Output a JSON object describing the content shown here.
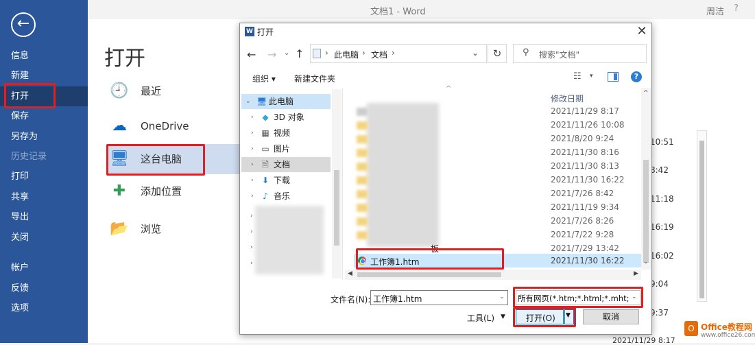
{
  "word": {
    "title": "文档1  -  Word",
    "user": "周洁",
    "help": "?"
  },
  "sidebar": {
    "items": [
      {
        "label": "信息"
      },
      {
        "label": "新建"
      },
      {
        "label": "打开"
      },
      {
        "label": "保存"
      },
      {
        "label": "另存为"
      },
      {
        "label": "历史记录"
      },
      {
        "label": "打印"
      },
      {
        "label": "共享"
      },
      {
        "label": "导出"
      },
      {
        "label": "关闭"
      },
      {
        "label": "帐户"
      },
      {
        "label": "反馈"
      },
      {
        "label": "选项"
      }
    ]
  },
  "open_page": {
    "title": "打开",
    "locations": [
      {
        "label": "最近",
        "icon": "clock-icon"
      },
      {
        "label": "OneDrive",
        "icon": "cloud-icon"
      },
      {
        "label": "这台电脑",
        "icon": "computer-icon"
      },
      {
        "label": "添加位置",
        "icon": "plus-icon"
      },
      {
        "label": "浏览",
        "icon": "folder-icon"
      }
    ],
    "recent_times": [
      "10:51",
      "8:42",
      "11:18",
      "16:19",
      "16:02",
      "9:04",
      "9:37",
      "2021/11/29 8:17"
    ]
  },
  "watermark": {
    "name": "Office教程网",
    "url": "www.office26.com"
  },
  "dialog": {
    "title": "打开",
    "address": {
      "pc": "此电脑",
      "docs": "文档"
    },
    "search_placeholder": "搜索\"文档\"",
    "organize": "组织 ▾",
    "new_folder": "新建文件夹",
    "tree": [
      {
        "label": "此电脑",
        "icon": "pc",
        "exp": "⌄"
      },
      {
        "label": "3D 对象",
        "icon": "3d",
        "exp": "›"
      },
      {
        "label": "视频",
        "icon": "video",
        "exp": "›"
      },
      {
        "label": "图片",
        "icon": "pictures",
        "exp": "›"
      },
      {
        "label": "文档",
        "icon": "documents",
        "exp": "›"
      },
      {
        "label": "下载",
        "icon": "download",
        "exp": "›"
      },
      {
        "label": "音乐",
        "icon": "music",
        "exp": "›"
      }
    ],
    "column_date": "修改日期",
    "dates": [
      "2021/11/29 8:17",
      "2021/11/26 10:08",
      "2021/8/20 9:24",
      "2021/11/30 8:16",
      "2021/11/30 8:13",
      "2021/11/30 16:22",
      "2021/7/26 8:42",
      "2021/11/19 9:34",
      "2021/7/26 8:26",
      "2021/7/22 9:28",
      "2021/7/29 13:42"
    ],
    "partial_label": "板",
    "selected_file": {
      "name": "工作簿1.htm",
      "date": "2021/11/30 16:22"
    },
    "filename_label": "文件名(N):",
    "filename_value": "工作簿1.htm",
    "filetype_value": "所有网页(*.htm;*.html;*.mht;*.",
    "tools_label": "工具(L)",
    "open_label": "打开(O)",
    "cancel_label": "取消"
  }
}
